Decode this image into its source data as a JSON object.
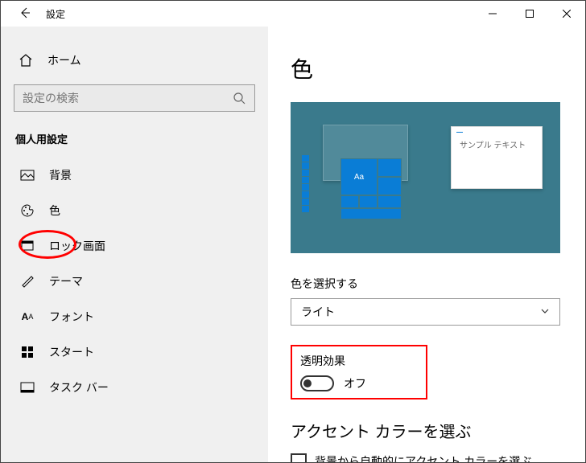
{
  "window": {
    "title": "設定"
  },
  "sidebar": {
    "home": "ホーム",
    "search_placeholder": "設定の検索",
    "section_label": "個人用設定",
    "items": [
      {
        "label": "背景"
      },
      {
        "label": "色"
      },
      {
        "label": "ロック画面"
      },
      {
        "label": "テーマ"
      },
      {
        "label": "フォント"
      },
      {
        "label": "スタート"
      },
      {
        "label": "タスク バー"
      }
    ]
  },
  "main": {
    "heading": "色",
    "preview_sample_text": "サンプル テキスト",
    "preview_tile_text": "Aa",
    "choose_color_label": "色を選択する",
    "color_mode_value": "ライト",
    "transparency_label": "透明効果",
    "transparency_value": "オフ",
    "accent_heading": "アクセント カラーを選ぶ",
    "auto_accent_label": "背景から自動的にアクセント カラーを選ぶ"
  }
}
